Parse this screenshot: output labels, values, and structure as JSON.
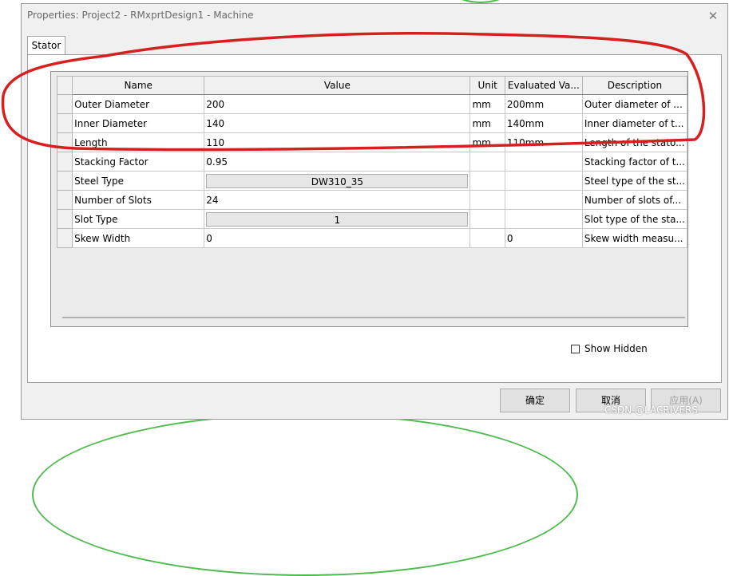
{
  "window": {
    "title": "Properties: Project2 - RMxprtDesign1 - Machine"
  },
  "tabs": [
    {
      "label": "Stator"
    }
  ],
  "table": {
    "columns": [
      "Name",
      "Value",
      "Unit",
      "Evaluated Va...",
      "Description"
    ],
    "rows": [
      {
        "name": "Outer Diameter",
        "value": "200",
        "unit": "mm",
        "evaluated": "200mm",
        "description": "Outer diameter of ..."
      },
      {
        "name": "Inner Diameter",
        "value": "140",
        "unit": "mm",
        "evaluated": "140mm",
        "description": "Inner diameter of t..."
      },
      {
        "name": "Length",
        "value": "110",
        "unit": "mm",
        "evaluated": "110mm",
        "description": "Length of the stato..."
      },
      {
        "name": "Stacking Factor",
        "value": "0.95",
        "unit": "",
        "evaluated": "",
        "description": "Stacking factor of t..."
      },
      {
        "name": "Steel Type",
        "value": "DW310_35",
        "unit": "",
        "evaluated": "",
        "description": "Steel type of the st..."
      },
      {
        "name": "Number of Slots",
        "value": "24",
        "unit": "",
        "evaluated": "",
        "description": "Number of slots of..."
      },
      {
        "name": "Slot Type",
        "value": "1",
        "unit": "",
        "evaluated": "",
        "description": "Slot type of the sta..."
      },
      {
        "name": "Skew Width",
        "value": "0",
        "unit": "",
        "evaluated": "0",
        "description": "Skew width measu..."
      }
    ]
  },
  "show_hidden": {
    "label": "Show Hidden",
    "checked": false
  },
  "buttons": {
    "ok": "确定",
    "cancel": "取消",
    "apply": "应用(A)"
  },
  "watermark": "CSDN @LACRIVERS",
  "colors": {
    "annotation_ink": "#d61f1f",
    "background_arc": "#4cbb4c"
  }
}
